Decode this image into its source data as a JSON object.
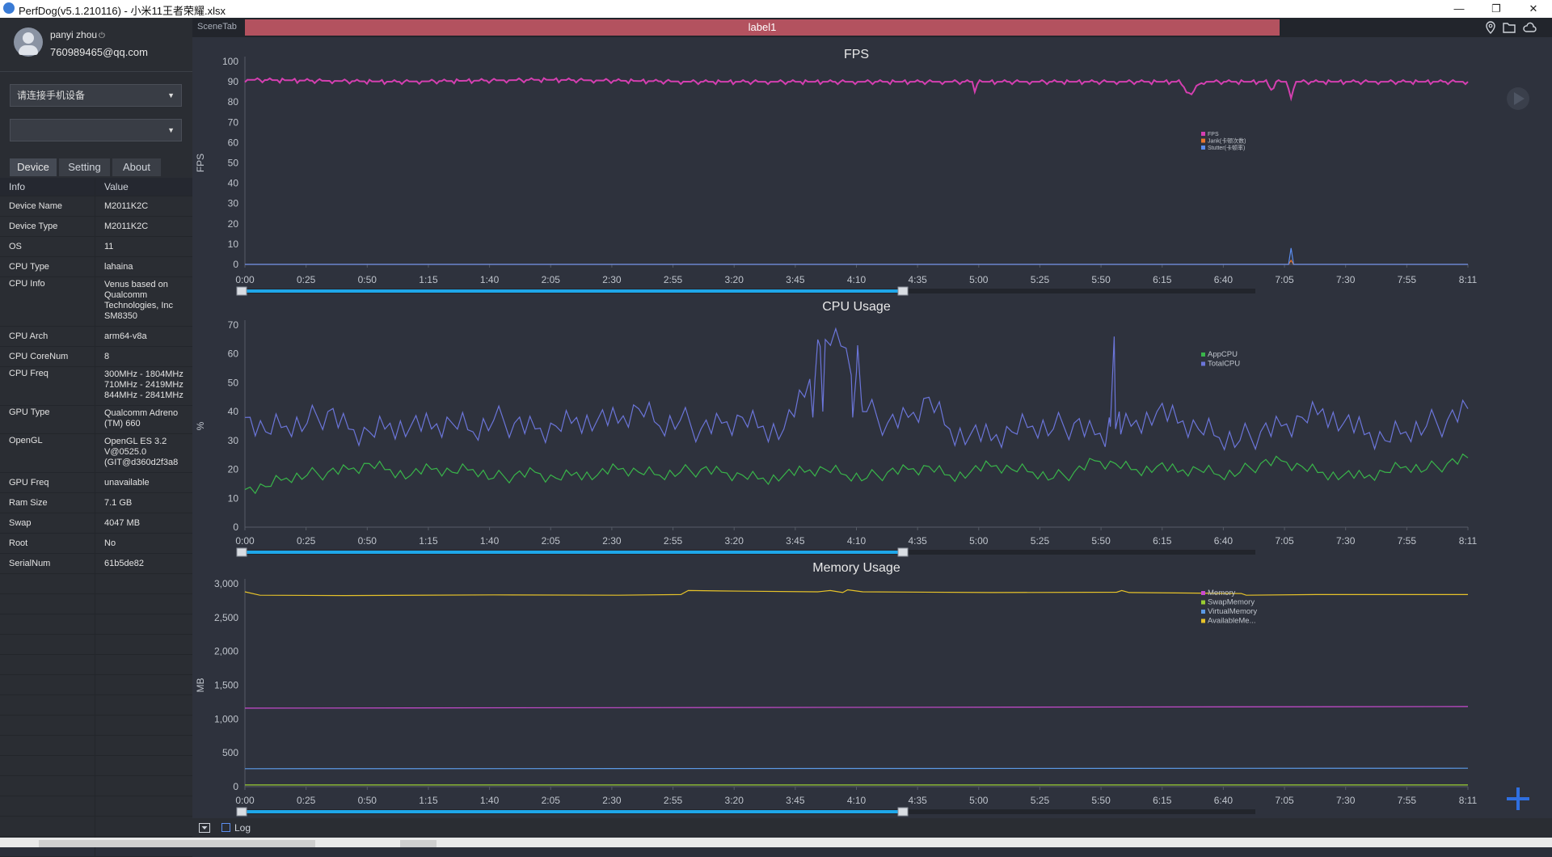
{
  "window": {
    "title": "PerfDog(v5.1.210116) - 小米11王者荣耀.xlsx",
    "minimize": "—",
    "restore": "❐",
    "close": "✕"
  },
  "user": {
    "name": "panyi zhou",
    "email": "760989465@qq.com",
    "power_icon": "power-icon"
  },
  "device_select": {
    "value": "请连接手机设备"
  },
  "app_select": {
    "value": ""
  },
  "tabs": [
    "Device",
    "Setting",
    "About"
  ],
  "info_table": {
    "headers": [
      "Info",
      "Value"
    ],
    "rows": [
      {
        "k": "Device Name",
        "v": [
          "M2011K2C"
        ]
      },
      {
        "k": "Device Type",
        "v": [
          "M2011K2C"
        ]
      },
      {
        "k": "OS",
        "v": [
          "11"
        ]
      },
      {
        "k": "CPU Type",
        "v": [
          "lahaina"
        ]
      },
      {
        "k": "CPU Info",
        "v": [
          "Venus based on",
          "Qualcomm",
          "Technologies, Inc",
          "SM8350"
        ]
      },
      {
        "k": "CPU Arch",
        "v": [
          "arm64-v8a"
        ]
      },
      {
        "k": "CPU CoreNum",
        "v": [
          "8"
        ]
      },
      {
        "k": "CPU Freq",
        "v": [
          "300MHz - 1804MHz",
          "710MHz - 2419MHz",
          "844MHz - 2841MHz"
        ]
      },
      {
        "k": "GPU Type",
        "v": [
          "Qualcomm Adreno",
          "(TM) 660"
        ]
      },
      {
        "k": "OpenGL",
        "v": [
          "OpenGL ES 3.2",
          "V@0525.0",
          "(GIT@d360d2f3a8"
        ]
      },
      {
        "k": "GPU Freq",
        "v": [
          "unavailable"
        ]
      },
      {
        "k": "Ram Size",
        "v": [
          "7.1 GB"
        ]
      },
      {
        "k": "Swap",
        "v": [
          "4047 MB"
        ]
      },
      {
        "k": "Root",
        "v": [
          "No"
        ]
      },
      {
        "k": "SerialNum",
        "v": [
          "61b5de82"
        ]
      }
    ]
  },
  "scene": {
    "tab_label": "SceneTab",
    "label": "label1"
  },
  "toolbar_icons": [
    "location-icon",
    "folder-icon",
    "cloud-icon"
  ],
  "bottom": {
    "log_label": "Log"
  },
  "colors": {
    "fps": "#d43fb0",
    "jank": "#e8762e",
    "stutter": "#5b8def",
    "app_cpu": "#39b54a",
    "total_cpu": "#6b75d9",
    "memory": "#c94bd0",
    "swap": "#9acd32",
    "virtual": "#5c9ae6",
    "available": "#e6c229",
    "slider": "#1ea7ea",
    "label_bar": "#b3525f"
  },
  "x_ticks": [
    "0:00",
    "0:25",
    "0:50",
    "1:15",
    "1:40",
    "2:05",
    "2:30",
    "2:55",
    "3:20",
    "3:45",
    "4:10",
    "4:35",
    "5:00",
    "5:25",
    "5:50",
    "6:15",
    "6:40",
    "7:05",
    "7:30",
    "7:55",
    "8:11"
  ],
  "chart_data": [
    {
      "type": "line",
      "title": "FPS",
      "ylabel": "FPS",
      "ylim": [
        0,
        100
      ],
      "yticks": [
        "0",
        "10",
        "20",
        "30",
        "40",
        "50",
        "60",
        "70",
        "80",
        "90",
        "100"
      ],
      "x_range_seconds": [
        0,
        491
      ],
      "legend": [
        "FPS",
        "Jank(卡顿次数)",
        "Stutter(卡顿率)"
      ],
      "legend_position": "right",
      "series": [
        {
          "name": "FPS",
          "color": "#d43fb0",
          "baseline": 90,
          "points": [
            [
              0,
              91
            ],
            [
              60,
              90
            ],
            [
              120,
              91
            ],
            [
              180,
              90
            ],
            [
              240,
              90
            ],
            [
              292,
              90
            ],
            [
              293,
              85
            ],
            [
              294,
              90
            ],
            [
              330,
              90
            ],
            [
              360,
              90
            ],
            [
              375,
              90
            ],
            [
              378,
              86
            ],
            [
              380,
              83
            ],
            [
              382,
              88
            ],
            [
              385,
              90
            ],
            [
              410,
              90
            ],
            [
              412,
              86
            ],
            [
              414,
              90
            ],
            [
              418,
              90
            ],
            [
              420,
              83
            ],
            [
              422,
              90
            ],
            [
              491,
              90
            ]
          ]
        },
        {
          "name": "Jank(卡顿次数)",
          "color": "#e8762e",
          "points": [
            [
              0,
              0
            ],
            [
              419,
              0
            ],
            [
              420,
              2
            ],
            [
              421,
              0
            ],
            [
              491,
              0
            ]
          ]
        },
        {
          "name": "Stutter(卡顿率)",
          "color": "#5b8def",
          "points": [
            [
              0,
              0
            ],
            [
              419,
              0
            ],
            [
              420,
              8
            ],
            [
              421,
              0
            ],
            [
              491,
              0
            ]
          ]
        }
      ]
    },
    {
      "type": "line",
      "title": "CPU Usage",
      "ylabel": "%",
      "ylim": [
        0,
        70
      ],
      "yticks": [
        "0",
        "10",
        "20",
        "30",
        "40",
        "50",
        "60",
        "70"
      ],
      "x_range_seconds": [
        0,
        491
      ],
      "legend": [
        "AppCPU",
        "TotalCPU"
      ],
      "legend_position": "right",
      "series": [
        {
          "name": "AppCPU",
          "color": "#39b54a",
          "values_every_10s": [
            13,
            14,
            17,
            18,
            19,
            20,
            22,
            20,
            18,
            20,
            19,
            20,
            17,
            18,
            19,
            17,
            19,
            18,
            20,
            19,
            18,
            19,
            20,
            19,
            18,
            17,
            18,
            19,
            20,
            18,
            17,
            19,
            20,
            21,
            18,
            19,
            21,
            20,
            19,
            17,
            19,
            23,
            22,
            20,
            21,
            19,
            20,
            18,
            19,
            22,
            23,
            21,
            19,
            18,
            17,
            19,
            21,
            20,
            22,
            24
          ]
        },
        {
          "name": "TotalCPU",
          "color": "#6b75d9",
          "values_every_10s": [
            38,
            33,
            35,
            36,
            40,
            34,
            33,
            36,
            35,
            34,
            36,
            33,
            37,
            36,
            34,
            35,
            38,
            37,
            36,
            41,
            35,
            37,
            34,
            36,
            38,
            35,
            34,
            45,
            65,
            62,
            40,
            36,
            38,
            45,
            34,
            32,
            30,
            33,
            35,
            34,
            36,
            32,
            34,
            37,
            40,
            36,
            34,
            31,
            30,
            33,
            35,
            38,
            41,
            36,
            32,
            30,
            33,
            35,
            37,
            41
          ]
        }
      ],
      "peaks": [
        [
          230,
          65
        ],
        [
          246,
          63
        ],
        [
          349,
          66
        ]
      ]
    },
    {
      "type": "line",
      "title": "Memory Usage",
      "ylabel": "MB",
      "ylim": [
        0,
        3000
      ],
      "yticks": [
        "0",
        "500",
        "1,000",
        "1,500",
        "2,000",
        "2,500",
        "3,000"
      ],
      "x_range_seconds": [
        0,
        491
      ],
      "legend": [
        "Memory",
        "SwapMemory",
        "VirtualMemory",
        "AvailableMe..."
      ],
      "legend_position": "right",
      "series": [
        {
          "name": "Memory",
          "color": "#c94bd0",
          "points": [
            [
              0,
              1160
            ],
            [
              491,
              1185
            ]
          ]
        },
        {
          "name": "SwapMemory",
          "color": "#9acd32",
          "points": [
            [
              0,
              25
            ],
            [
              491,
              25
            ]
          ]
        },
        {
          "name": "VirtualMemory",
          "color": "#5c9ae6",
          "points": [
            [
              0,
              265
            ],
            [
              491,
              272
            ]
          ]
        },
        {
          "name": "AvailableMe...",
          "color": "#e6c229",
          "points": [
            [
              0,
              2880
            ],
            [
              6,
              2830
            ],
            [
              40,
              2825
            ],
            [
              100,
              2835
            ],
            [
              150,
              2830
            ],
            [
              175,
              2840
            ],
            [
              178,
              2900
            ],
            [
              200,
              2890
            ],
            [
              230,
              2880
            ],
            [
              235,
              2900
            ],
            [
              240,
              2870
            ],
            [
              242,
              2910
            ],
            [
              248,
              2880
            ],
            [
              300,
              2870
            ],
            [
              350,
              2875
            ],
            [
              352,
              2900
            ],
            [
              355,
              2870
            ],
            [
              400,
              2855
            ],
            [
              402,
              2830
            ],
            [
              430,
              2840
            ],
            [
              491,
              2840
            ]
          ]
        }
      ]
    }
  ]
}
